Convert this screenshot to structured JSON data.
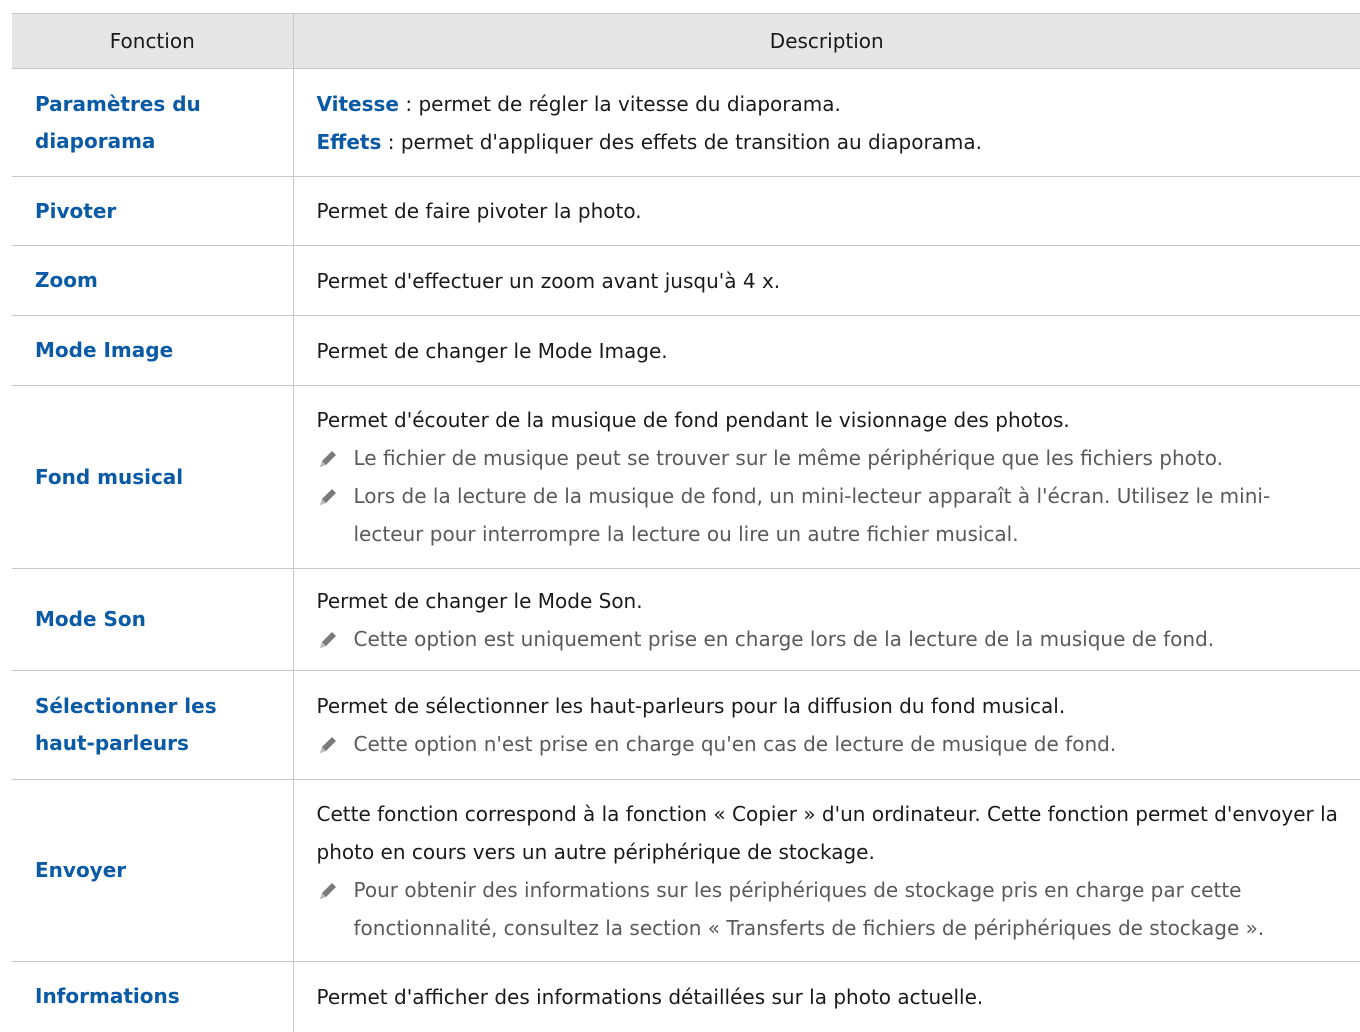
{
  "header": {
    "col_function": "Fonction",
    "col_description": "Description"
  },
  "rows": [
    {
      "function": "Paramètres du diaporama",
      "items": [
        {
          "kw": "Vitesse",
          "text": " : permet de régler la vitesse du diaporama."
        },
        {
          "kw": "Effets",
          "text": " : permet d'appliquer des effets de transition au diaporama."
        }
      ]
    },
    {
      "function": "Pivoter",
      "text": "Permet de faire pivoter la photo."
    },
    {
      "function": "Zoom",
      "text": "Permet d'effectuer un zoom avant jusqu'à 4 x."
    },
    {
      "function": "Mode Image",
      "text": "Permet de changer le Mode Image."
    },
    {
      "function": "Fond musical",
      "text": "Permet d'écouter de la musique de fond pendant le visionnage des photos.",
      "notes": [
        "Le fichier de musique peut se trouver sur le même périphérique que les fichiers photo.",
        "Lors de la lecture de la musique de fond, un mini-lecteur apparaît à l'écran. Utilisez le mini-lecteur pour interrompre la lecture ou lire un autre fichier musical."
      ]
    },
    {
      "function": "Mode Son",
      "text": "Permet de changer le Mode Son.",
      "notes": [
        "Cette option est uniquement prise en charge lors de la lecture de la musique de fond."
      ]
    },
    {
      "function": "Sélectionner les haut-parleurs",
      "text": "Permet de sélectionner les haut-parleurs pour la diffusion du fond musical.",
      "notes": [
        "Cette option n'est prise en charge qu'en cas de lecture de musique de fond."
      ]
    },
    {
      "function": "Envoyer",
      "text": "Cette fonction correspond à la fonction « Copier » d'un ordinateur. Cette fonction permet d'envoyer la photo en cours vers un autre périphérique de stockage.",
      "notes": [
        "Pour obtenir des informations sur les périphériques de stockage pris en charge par cette fonctionnalité, consultez la section « Transferts de fichiers de périphériques de stockage »."
      ]
    },
    {
      "function": "Informations",
      "text": "Permet d'afficher des informations détaillées sur la photo actuelle."
    }
  ]
}
